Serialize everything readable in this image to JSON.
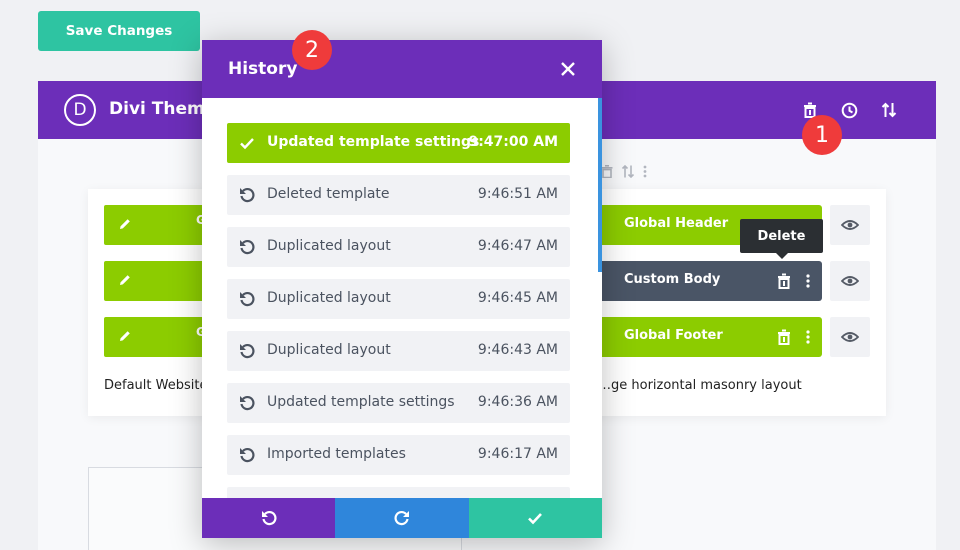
{
  "toolbar": {
    "save_label": "Save Changes"
  },
  "builder": {
    "logo_letter": "D",
    "title": "Divi Theme Builder",
    "icons": [
      "trash-icon",
      "history-icon",
      "sort-icon"
    ]
  },
  "left_card": {
    "bars": [
      {
        "label": "G",
        "icon": "pencil-icon"
      },
      {
        "label": "",
        "icon": "pencil-icon"
      },
      {
        "label": "G",
        "icon": "pencil-icon"
      }
    ],
    "caption": "Default Website Template"
  },
  "right_card": {
    "bars": [
      {
        "label": "Global Header"
      },
      {
        "label": "Custom Body"
      },
      {
        "label": "Global Footer"
      }
    ],
    "caption": "…ge horizontal masonry layout"
  },
  "tooltip": "Delete",
  "badges": [
    "1",
    "2"
  ],
  "history": {
    "title": "History",
    "items": [
      {
        "label": "Updated template settings",
        "time": "9:47:00 AM",
        "active": true
      },
      {
        "label": "Deleted template",
        "time": "9:46:51 AM",
        "active": false
      },
      {
        "label": "Duplicated layout",
        "time": "9:46:47 AM",
        "active": false
      },
      {
        "label": "Duplicated layout",
        "time": "9:46:45 AM",
        "active": false
      },
      {
        "label": "Duplicated layout",
        "time": "9:46:43 AM",
        "active": false
      },
      {
        "label": "Updated template settings",
        "time": "9:46:36 AM",
        "active": false
      },
      {
        "label": "Imported templates",
        "time": "9:46:17 AM",
        "active": false
      },
      {
        "label": "",
        "time": "",
        "active": false
      }
    ],
    "footer": [
      "undo-icon",
      "redo-icon",
      "check-icon"
    ]
  },
  "colors": {
    "purple": "#6c2eb9",
    "green": "#8ccc00",
    "teal": "#2ec4a2",
    "blue": "#2f86db",
    "dark": "#4a5566",
    "badge_red": "#ef3b3b"
  }
}
